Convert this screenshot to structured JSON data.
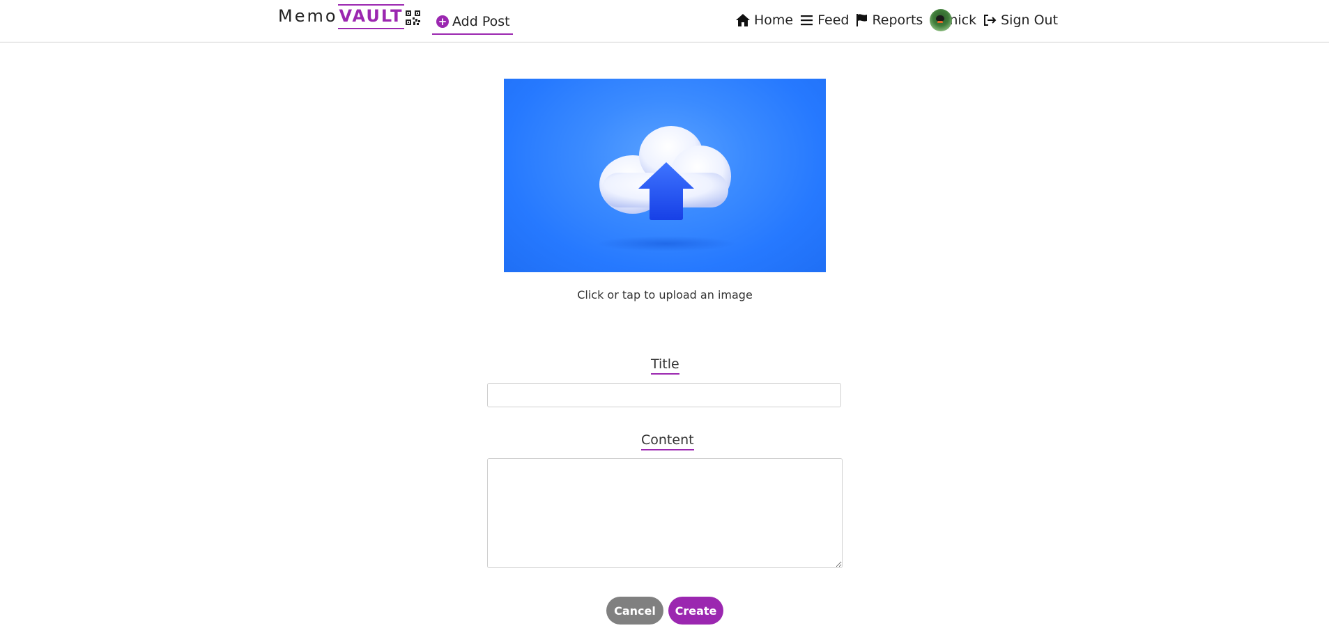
{
  "navbar": {
    "brand_memo": "Memo",
    "brand_vault": "VAULT",
    "qr_icon": "qr-code-icon",
    "add_post_label": "Add Post",
    "home_label": "Home",
    "feed_label": "Feed",
    "reports_label": "Reports",
    "username": "nick",
    "sign_out_label": "Sign Out"
  },
  "upload": {
    "caption": "Click or tap to upload an image",
    "icon": "cloud-upload-icon"
  },
  "form": {
    "title_label": "Title",
    "title_value": "",
    "content_label": "Content",
    "content_value": ""
  },
  "actions": {
    "cancel_label": "Cancel",
    "create_label": "Create"
  },
  "colors": {
    "accent": "#9b27b0",
    "cancel": "#808080",
    "upload_bg": "#2679ff"
  }
}
